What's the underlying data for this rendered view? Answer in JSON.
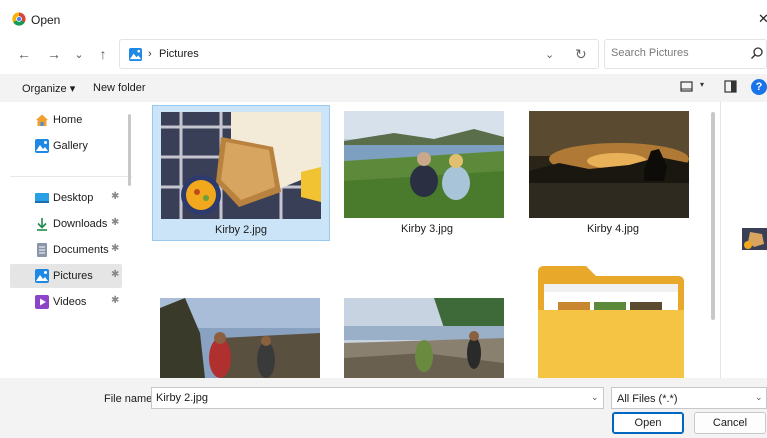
{
  "window": {
    "title": "Open",
    "close_glyph": "✕"
  },
  "nav": {
    "back": "←",
    "forward": "→",
    "recent": "⌄",
    "up": "↑"
  },
  "address": {
    "crumb_separator": "›",
    "crumb": "Pictures",
    "dropdown": "⌄",
    "refresh": "↻"
  },
  "search": {
    "placeholder": "Search Pictures"
  },
  "toolbar": {
    "organize": "Organize ▾",
    "new_folder": "New folder",
    "view_dropdown": "▾",
    "help": "?"
  },
  "sidebar": {
    "items": [
      {
        "label": "Home",
        "icon": "home-icon",
        "pinned": false
      },
      {
        "label": "Gallery",
        "icon": "gallery-icon",
        "pinned": false
      },
      {
        "label": "Desktop",
        "icon": "desktop-icon",
        "pinned": true
      },
      {
        "label": "Downloads",
        "icon": "download-icon",
        "pinned": true
      },
      {
        "label": "Documents",
        "icon": "documents-icon",
        "pinned": true
      },
      {
        "label": "Pictures",
        "icon": "pictures-icon",
        "pinned": true,
        "selected": true
      },
      {
        "label": "Videos",
        "icon": "videos-icon",
        "pinned": true
      }
    ],
    "pin_glyph": "✱"
  },
  "files": [
    {
      "name": "Kirby 2.jpg",
      "selected": true
    },
    {
      "name": "Kirby 3.jpg",
      "selected": false
    },
    {
      "name": "Kirby 4.jpg",
      "selected": false
    },
    {
      "name": "",
      "selected": false
    },
    {
      "name": "",
      "selected": false
    },
    {
      "name": "",
      "selected": false,
      "is_folder": true
    }
  ],
  "bottom": {
    "file_name_label": "File name:",
    "file_name_value": "Kirby 2.jpg",
    "file_type": "All Files (*.*)",
    "dropdown": "⌄",
    "open": "Open",
    "cancel": "Cancel"
  },
  "colors": {
    "accent": "#0067c0",
    "selection": "#cce4f7",
    "folder": "#f6c445"
  }
}
